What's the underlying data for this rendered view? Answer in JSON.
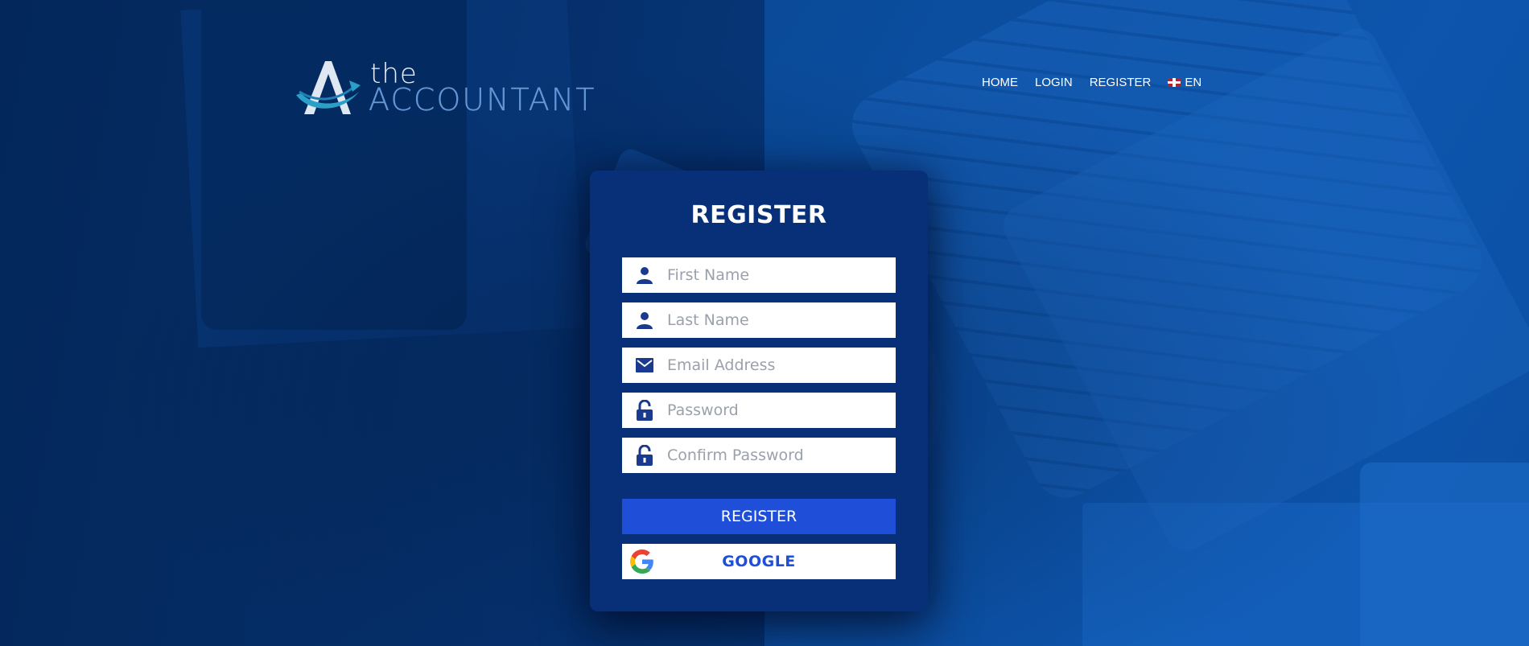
{
  "logo": {
    "the_text": "the",
    "accountant_text": "ACCOUNTANT",
    "icon": "accountant-a-logo"
  },
  "nav": {
    "items": [
      {
        "label": "HOME"
      },
      {
        "label": "LOGIN"
      },
      {
        "label": "REGISTER"
      }
    ],
    "language": {
      "label": "EN",
      "icon": "uk-flag-icon"
    }
  },
  "form": {
    "title": "REGISTER",
    "fields": {
      "first_name": {
        "placeholder": "First Name",
        "value": "",
        "icon": "user-icon"
      },
      "last_name": {
        "placeholder": "Last Name",
        "value": "",
        "icon": "user-icon"
      },
      "email": {
        "placeholder": "Email Address",
        "value": "",
        "icon": "envelope-icon"
      },
      "password": {
        "placeholder": "Password",
        "value": "",
        "icon": "lock-open-icon"
      },
      "confirm_password": {
        "placeholder": "Confirm Password",
        "value": "",
        "icon": "lock-open-icon"
      }
    },
    "register_button": "REGISTER",
    "google_button": "GOOGLE"
  },
  "colors": {
    "primary": "#1f4fd8",
    "card_bg": "#073078",
    "icon_color": "#1a3a8f"
  }
}
